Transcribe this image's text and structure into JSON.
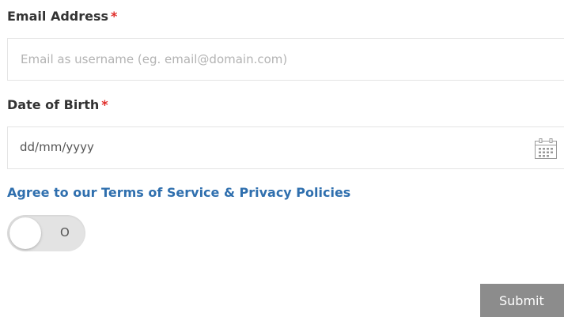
{
  "form": {
    "email": {
      "label": "Email Address",
      "required_marker": "*",
      "placeholder": "Email as username (eg. email@domain.com)",
      "value": ""
    },
    "dob": {
      "label": "Date of Birth",
      "required_marker": "*",
      "value": "dd/mm/yyyy",
      "icon": "calendar-icon"
    },
    "terms_link": "Agree to our Terms of Service & Privacy Policies",
    "terms_toggle": {
      "state_text": "O",
      "checked": false
    },
    "submit_label": "Submit"
  },
  "colors": {
    "label": "#333333",
    "required": "#e02b27",
    "link": "#2f6fae",
    "submit_bg": "#8c8c8c",
    "toggle_bg": "#e3e3e3",
    "border": "#e4e4e4"
  }
}
